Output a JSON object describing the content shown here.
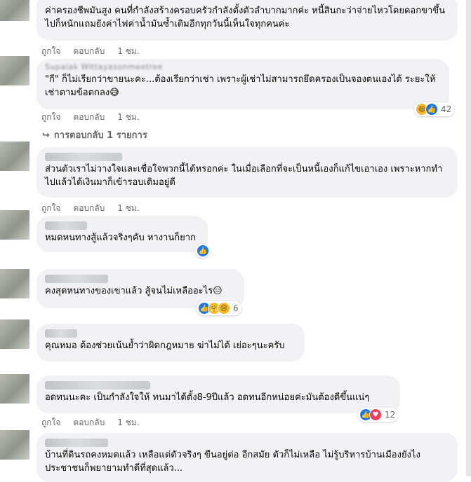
{
  "actions": {
    "like": "ถูกใจ",
    "reply": "ตอบกลับ",
    "time": "1 ชม."
  },
  "comments": [
    {
      "name": "",
      "text": "ค่าครองชีพมันสูง คนที่กำลังสร้างครอบครัวกำลังตั้งตัวลำบากมากค่ะ หนี้สินกะว่าจ่ายไหวโดยดอกขาขึ้นไปก็หนักแถมยังค่าไฟค่าน้ำมันซ้ำเติมอีกทุกวันนี้เห็นใจทุกคนค่ะ",
      "reactions": [],
      "count": ""
    },
    {
      "name": "Supalak Wittayasonmeetree",
      "text": "\"กี\" ก็ไม่เรียกว่าขายนะคะ...ต้องเรียกว่าเช่า เพราะผู้เช่าไม่สามารถยึดครองเป็นจองตนเองได้ ระยะให้เช่าตามข้อตกลง😅",
      "reactions": [
        "haha",
        "like"
      ],
      "count": "42"
    },
    {
      "name": "",
      "text": "ส่วนตัวเราไม่วางใจและเชื่อใจพวกนี้ได้หรอกค่ะ ในเมื่อเลือกที่จะเป็นหนี้เองก็แก้ไขเอาเอง เพราะหากทำไปแล้วได้เงินมาก็เข้ารอบเดิมอยู่ดี",
      "reactions": [],
      "count": ""
    },
    {
      "name": "",
      "text": "หมดหนทางสู้แล้วจริงๆคับ หางานก็ยาก",
      "reactions": [
        "like"
      ],
      "count": ""
    },
    {
      "name": "",
      "text": "คงสุดหนทางของเขาแล้ว สู้จนไม่เหลืออะไร😑",
      "reactions": [
        "like",
        "care",
        "sad"
      ],
      "count": "6"
    },
    {
      "name": "",
      "text": "คุณหมอ ต้องช่วยเน้นย้ำว่าผิดกฎหมาย ฆ่าไม่ได้ เย่อะๆนะครับ",
      "reactions": [],
      "count": ""
    },
    {
      "name": "",
      "text": "อดทนนะคะ เป็นกำลังใจให้ ทนมาได้ตั้ง8-9ปีแล้ว อดทนอีกหน่อยค่ะมันต้องดีขึ้นแน่ๆ",
      "reactions": [
        "like",
        "love"
      ],
      "count": "12"
    },
    {
      "name": "",
      "text": "บ้านที่ดินรถคงหมดแล้ว เหลือแต่ตัวจริงๆ ขืนอยู่ต่อ อีกสมัย ตัวก็ไม่เหลือ ไม่รู้บริหารบ้านเมืองยังไง ประชาชนก็พยายามทำดีที่สุดแล้ว...",
      "reactions": [],
      "count": ""
    }
  ],
  "replies_link": "การตอบกลับ 1 รายการ",
  "icons": {
    "like": "like-icon",
    "haha": "haha-icon",
    "care": "care-icon",
    "sad": "sad-icon",
    "love": "love-icon",
    "reply_arrow": "reply-arrow-icon"
  }
}
